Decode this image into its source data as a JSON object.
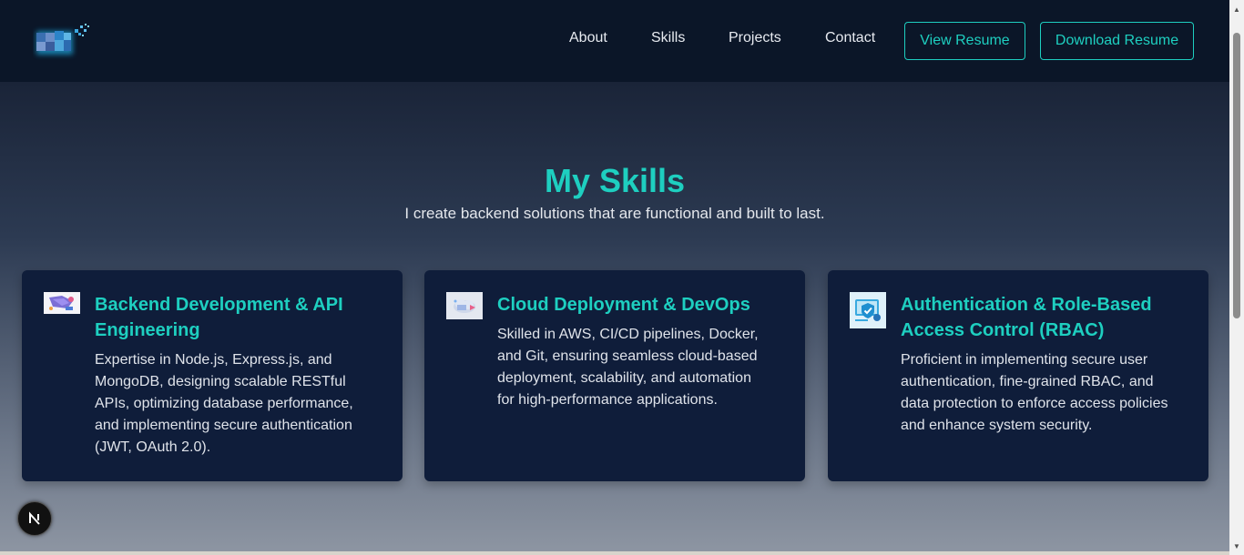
{
  "nav": {
    "links": [
      "About",
      "Skills",
      "Projects",
      "Contact"
    ],
    "view_resume": "View Resume",
    "download_resume": "Download Resume"
  },
  "skills": {
    "title": "My Skills",
    "subtitle": "I create backend solutions that are functional and built to last.",
    "cards": [
      {
        "icon": "api-illustration-icon",
        "title": "Backend Development & API Engineering",
        "desc": "Expertise in Node.js, Express.js, and MongoDB, designing scalable RESTful APIs, optimizing database performance, and implementing secure authentication (JWT, OAuth 2.0)."
      },
      {
        "icon": "cloud-devops-icon",
        "title": "Cloud Deployment & DevOps",
        "desc": "Skilled in AWS, CI/CD pipelines, Docker, and Git, ensuring seamless cloud-based deployment, scalability, and automation for high-performance applications."
      },
      {
        "icon": "shield-auth-icon",
        "title": "Authentication & Role-Based Access Control (RBAC)",
        "desc": "Proficient in implementing secure user authentication, fine-grained RBAC, and data protection to enforce access policies and enhance system security."
      }
    ]
  },
  "badge": {
    "letter": "N"
  },
  "colors": {
    "accent": "#1ecfc0",
    "nav_bg": "#0b1628",
    "card_bg": "#0f1d3a"
  }
}
